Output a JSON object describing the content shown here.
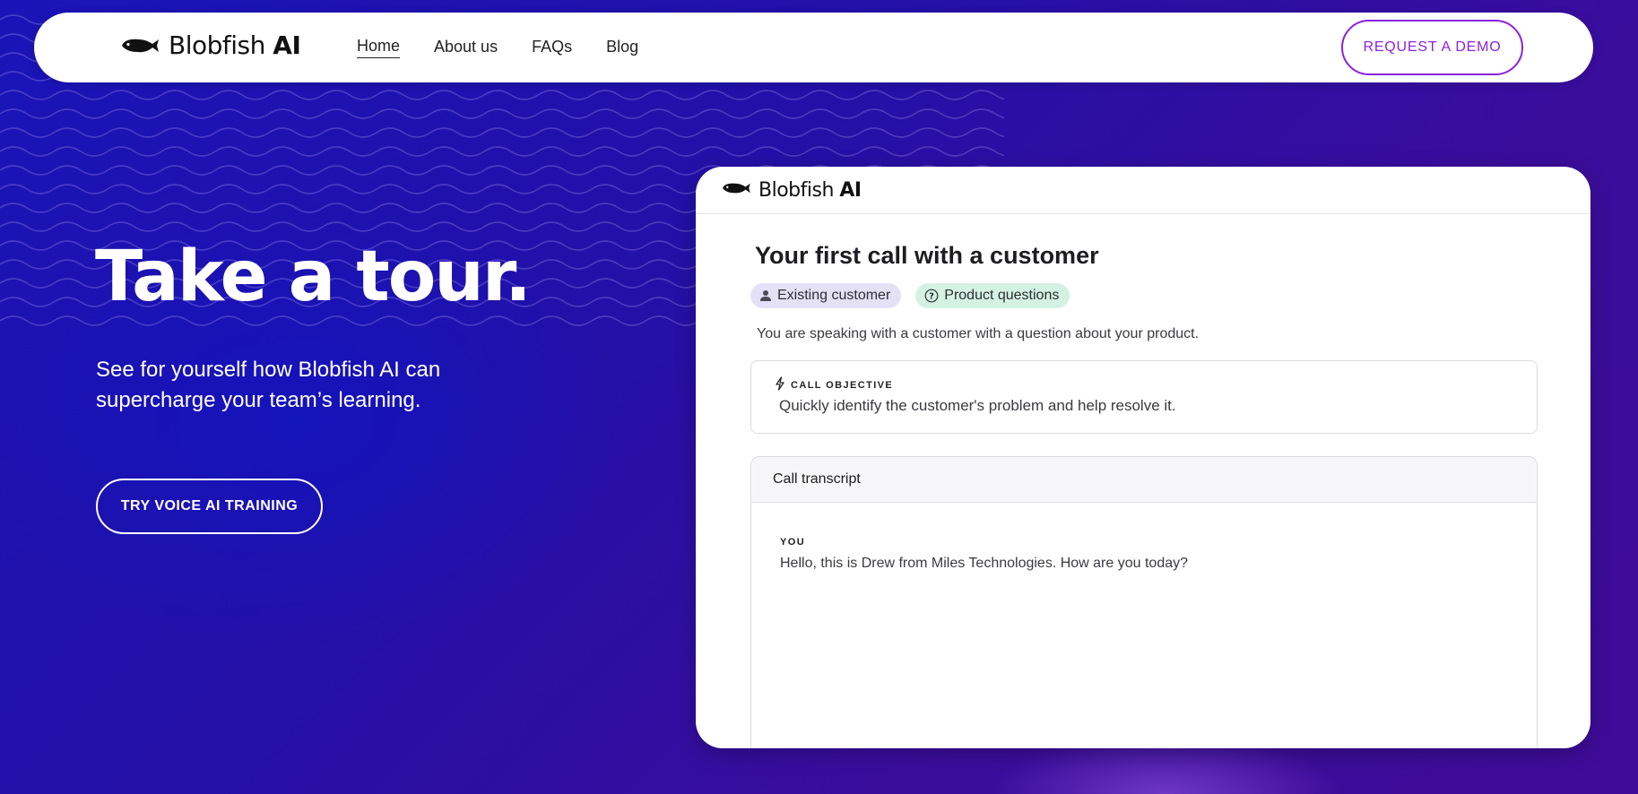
{
  "nav": {
    "logo_name": "Blobfish",
    "logo_suffix": "AI",
    "links": [
      {
        "label": "Home",
        "active": true
      },
      {
        "label": "About us",
        "active": false
      },
      {
        "label": "FAQs",
        "active": false
      },
      {
        "label": "Blog",
        "active": false
      }
    ],
    "cta_label": "REQUEST A DEMO"
  },
  "hero": {
    "title": "Take a tour.",
    "subtitle": "See for yourself how Blobfish AI can supercharge your team’s learning.",
    "cta_label": "TRY VOICE AI TRAINING"
  },
  "demo_card": {
    "logo_name": "Blobfish",
    "logo_suffix": "AI",
    "title": "Your first call with a customer",
    "tags": [
      {
        "label": "Existing customer",
        "icon": "person-icon",
        "color": "#e4e1f7"
      },
      {
        "label": "Product questions",
        "icon": "question-circle-icon",
        "color": "#d4f2e4"
      }
    ],
    "description": "You are speaking with a customer with a question about your product.",
    "objective": {
      "label": "CALL OBJECTIVE",
      "icon": "lightning-icon",
      "text": "Quickly identify the customer's problem and help resolve it."
    },
    "transcript": {
      "header": "Call transcript",
      "entries": [
        {
          "speaker": "YOU",
          "text": "Hello, this is Drew from Miles Technologies. How are you today?"
        }
      ]
    }
  },
  "colors": {
    "accent": "#8a22e0",
    "background_start": "#1a14b8",
    "background_end": "#3f0c98",
    "text_light": "#ffffff"
  }
}
